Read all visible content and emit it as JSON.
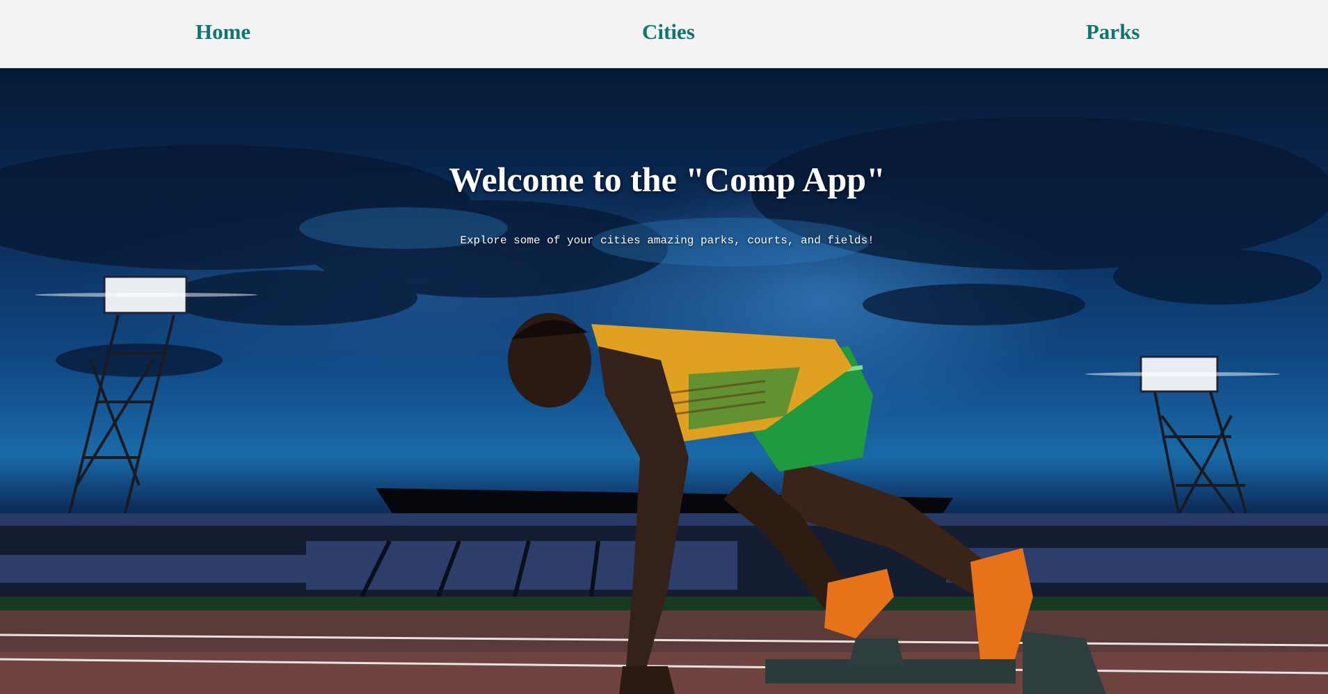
{
  "nav": {
    "items": [
      {
        "label": "Home"
      },
      {
        "label": "Cities"
      },
      {
        "label": "Parks"
      }
    ]
  },
  "hero": {
    "title": "Welcome to the \"Comp App\"",
    "subtitle": "Explore some of your cities amazing parks, courts, and fields!"
  },
  "colors": {
    "nav_background": "#f3f3f3",
    "nav_link": "#0f7573",
    "hero_text": "#ffffff"
  }
}
